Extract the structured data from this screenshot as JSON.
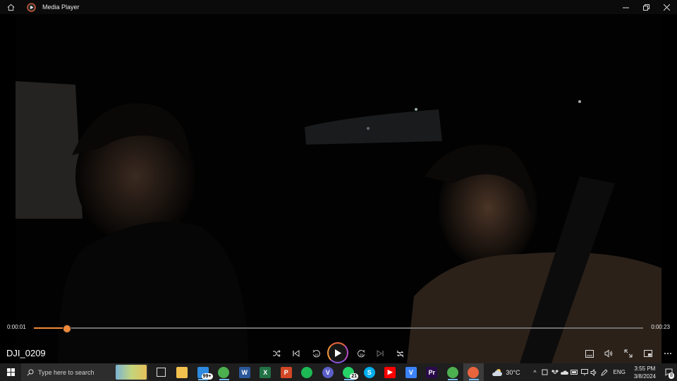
{
  "window": {
    "title": "Media Player"
  },
  "video": {
    "filename": "DJI_0209"
  },
  "playback": {
    "current_time": "0:00:01",
    "duration": "0:00:23",
    "progress": 0.053
  },
  "taskbar": {
    "search_placeholder": "Type here to search",
    "apps": [
      {
        "name": "task-view",
        "glyph": "",
        "badge": ""
      },
      {
        "name": "file-explorer",
        "glyph": "",
        "badge": "",
        "color": "#f2c14e"
      },
      {
        "name": "mail",
        "glyph": "",
        "badge": "99+",
        "color": "#2d8ae0"
      },
      {
        "name": "chrome",
        "glyph": "",
        "badge": "",
        "color": "#4caf50"
      },
      {
        "name": "word",
        "glyph": "W",
        "badge": "",
        "color": "#2b579a"
      },
      {
        "name": "excel",
        "glyph": "X",
        "badge": "",
        "color": "#217346"
      },
      {
        "name": "powerpoint",
        "glyph": "P",
        "badge": "",
        "color": "#d24726"
      },
      {
        "name": "spotify",
        "glyph": "",
        "badge": "",
        "color": "#1db954"
      },
      {
        "name": "vpn",
        "glyph": "V",
        "badge": "",
        "color": "#5b5fc7"
      },
      {
        "name": "whatsapp",
        "glyph": "",
        "badge": "21",
        "color": "#25d366"
      },
      {
        "name": "skype",
        "glyph": "S",
        "badge": "",
        "color": "#00aff0"
      },
      {
        "name": "youtube",
        "glyph": "▶",
        "badge": "",
        "color": "#ff0000"
      },
      {
        "name": "vscode-v",
        "glyph": "V",
        "badge": "",
        "color": "#3b82f6"
      },
      {
        "name": "premiere",
        "glyph": "Pr",
        "badge": "",
        "color": "#2a0b4a"
      },
      {
        "name": "chrome-2",
        "glyph": "",
        "badge": "",
        "color": "#4caf50"
      },
      {
        "name": "media-player",
        "glyph": "",
        "badge": "",
        "color": "#e8643d"
      }
    ],
    "weather": "30°C",
    "language": "ENG",
    "time": "3:55 PM",
    "date": "3/8/2024",
    "notifications": "8"
  },
  "colors": {
    "accent": "#f08a3a",
    "titlebar": "#0b0b0b",
    "taskbar": "#1e1e1e"
  }
}
